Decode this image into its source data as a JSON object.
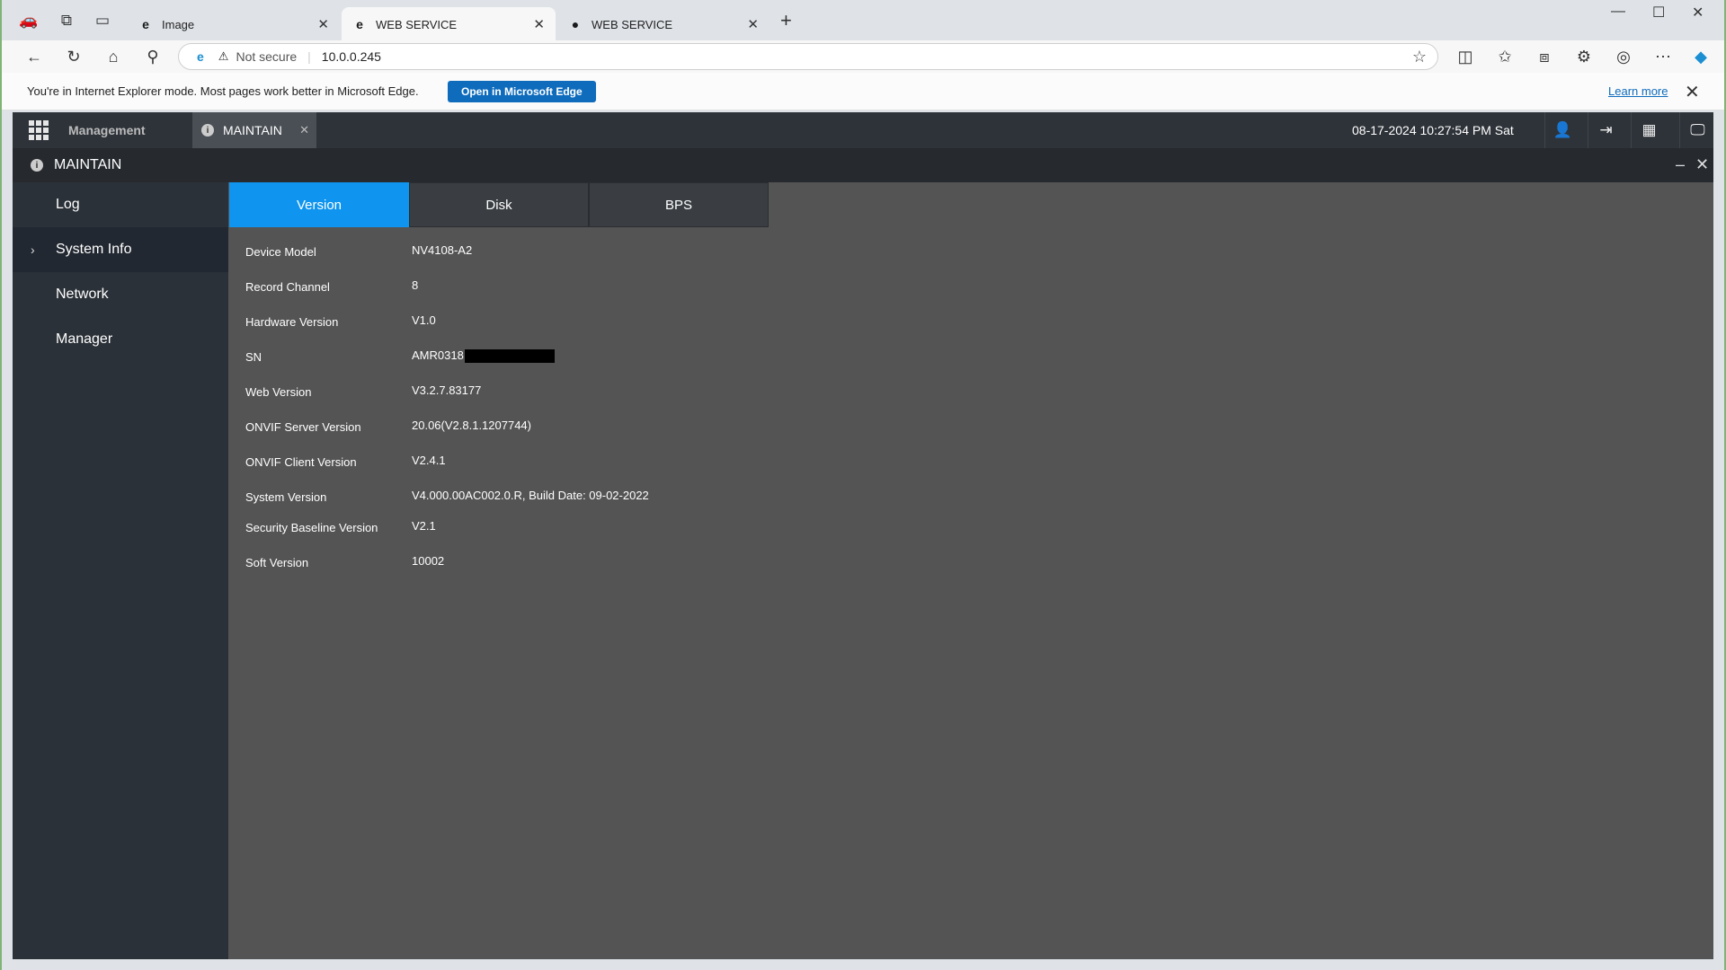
{
  "browser": {
    "tabs": [
      {
        "title": "Image",
        "icon": "ie-icon"
      },
      {
        "title": "WEB SERVICE",
        "icon": "ie-icon"
      },
      {
        "title": "WEB SERVICE",
        "icon": "globe-icon"
      }
    ],
    "security_label": "Not secure",
    "url": "10.0.0.245",
    "ie_banner": {
      "message": "You're in Internet Explorer mode. Most pages work better in Microsoft Edge.",
      "button": "Open in Microsoft Edge",
      "learn_more": "Learn more"
    }
  },
  "app": {
    "management_label": "Management",
    "open_tab": "MAINTAIN",
    "datetime": "08-17-2024 10:27:54 PM Sat",
    "panel_title": "MAINTAIN",
    "sidebar": [
      {
        "label": "Log",
        "selected": false
      },
      {
        "label": "System Info",
        "selected": true
      },
      {
        "label": "Network",
        "selected": false
      },
      {
        "label": "Manager",
        "selected": false
      }
    ],
    "tabs": [
      {
        "label": "Version",
        "active": true
      },
      {
        "label": "Disk",
        "active": false
      },
      {
        "label": "BPS",
        "active": false
      }
    ],
    "info": [
      {
        "label": "Device Model",
        "value": "NV4108-A2"
      },
      {
        "label": "Record Channel",
        "value": "8"
      },
      {
        "label": "Hardware Version",
        "value": "V1.0"
      },
      {
        "label": "SN",
        "value": "AMR0318",
        "redacted": true
      },
      {
        "label": "Web Version",
        "value": "V3.2.7.83177"
      },
      {
        "label": "ONVIF Server Version",
        "value": "20.06(V2.8.1.1207744)"
      },
      {
        "label": "ONVIF Client Version",
        "value": "V2.4.1"
      },
      {
        "label": "System Version",
        "value": "V4.000.00AC002.0.R, Build Date: 09-02-2022"
      },
      {
        "label": "Security Baseline Version",
        "value": "V2.1"
      },
      {
        "label": "Soft Version",
        "value": "10002"
      }
    ],
    "accent_color": "#0f95ef"
  }
}
